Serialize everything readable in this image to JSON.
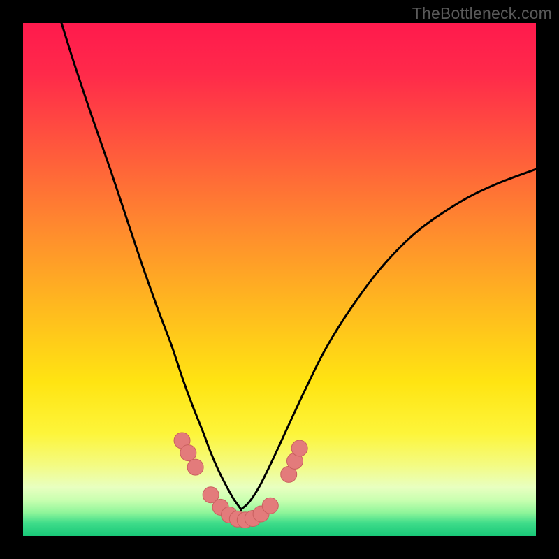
{
  "watermark": "TheBottleneck.com",
  "colors": {
    "frame": "#000000",
    "gradient_stops": [
      {
        "offset": 0.0,
        "color": "#ff1a4d"
      },
      {
        "offset": 0.1,
        "color": "#ff2a4a"
      },
      {
        "offset": 0.25,
        "color": "#ff5a3c"
      },
      {
        "offset": 0.4,
        "color": "#ff8a2e"
      },
      {
        "offset": 0.55,
        "color": "#ffb81f"
      },
      {
        "offset": 0.7,
        "color": "#ffe412"
      },
      {
        "offset": 0.8,
        "color": "#fdf53a"
      },
      {
        "offset": 0.86,
        "color": "#f4fb80"
      },
      {
        "offset": 0.905,
        "color": "#e8ffc0"
      },
      {
        "offset": 0.93,
        "color": "#c9ffb0"
      },
      {
        "offset": 0.955,
        "color": "#8ef59a"
      },
      {
        "offset": 0.975,
        "color": "#3fdc8a"
      },
      {
        "offset": 1.0,
        "color": "#18c878"
      }
    ],
    "curve_stroke": "#000000",
    "marker_fill": "#e37b7b",
    "marker_stroke": "#c95f5f"
  },
  "chart_data": {
    "type": "line",
    "title": "",
    "xlabel": "",
    "ylabel": "",
    "xlim": [
      0,
      100
    ],
    "ylim": [
      0,
      100
    ],
    "note": "Axes have no visible tick labels; values are percentages of the plotting area (0=left/bottom, 100=right/top). Two curves descend from the top edge toward a common minimum near the bottom, then the right curve rises again.",
    "series": [
      {
        "name": "left-curve",
        "x": [
          7.5,
          10,
          13,
          17,
          20,
          23,
          26,
          29,
          31,
          33,
          35,
          36.5,
          38,
          39.5,
          41,
          42.5
        ],
        "y": [
          100,
          92,
          83,
          71.5,
          62.5,
          53.5,
          45,
          37,
          31,
          25.5,
          20.5,
          16.5,
          13,
          10,
          7.3,
          5.2
        ]
      },
      {
        "name": "right-curve",
        "x": [
          42.5,
          44,
          46,
          48.5,
          51.5,
          55,
          59,
          64,
          70,
          77,
          85,
          92,
          100
        ],
        "y": [
          5.2,
          6.5,
          9.5,
          14.5,
          21,
          28.5,
          36.5,
          44.5,
          52.5,
          59.5,
          65,
          68.5,
          71.5
        ]
      }
    ],
    "markers": {
      "name": "highlighted-points",
      "points": [
        {
          "x": 31.0,
          "y": 18.6
        },
        {
          "x": 32.2,
          "y": 16.2
        },
        {
          "x": 33.6,
          "y": 13.4
        },
        {
          "x": 36.6,
          "y": 8.0
        },
        {
          "x": 38.5,
          "y": 5.6
        },
        {
          "x": 40.2,
          "y": 4.1
        },
        {
          "x": 41.8,
          "y": 3.3
        },
        {
          "x": 43.3,
          "y": 3.1
        },
        {
          "x": 44.8,
          "y": 3.4
        },
        {
          "x": 46.4,
          "y": 4.3
        },
        {
          "x": 48.2,
          "y": 5.9
        },
        {
          "x": 51.8,
          "y": 12.0
        },
        {
          "x": 53.0,
          "y": 14.6
        },
        {
          "x": 53.9,
          "y": 17.1
        }
      ]
    }
  }
}
